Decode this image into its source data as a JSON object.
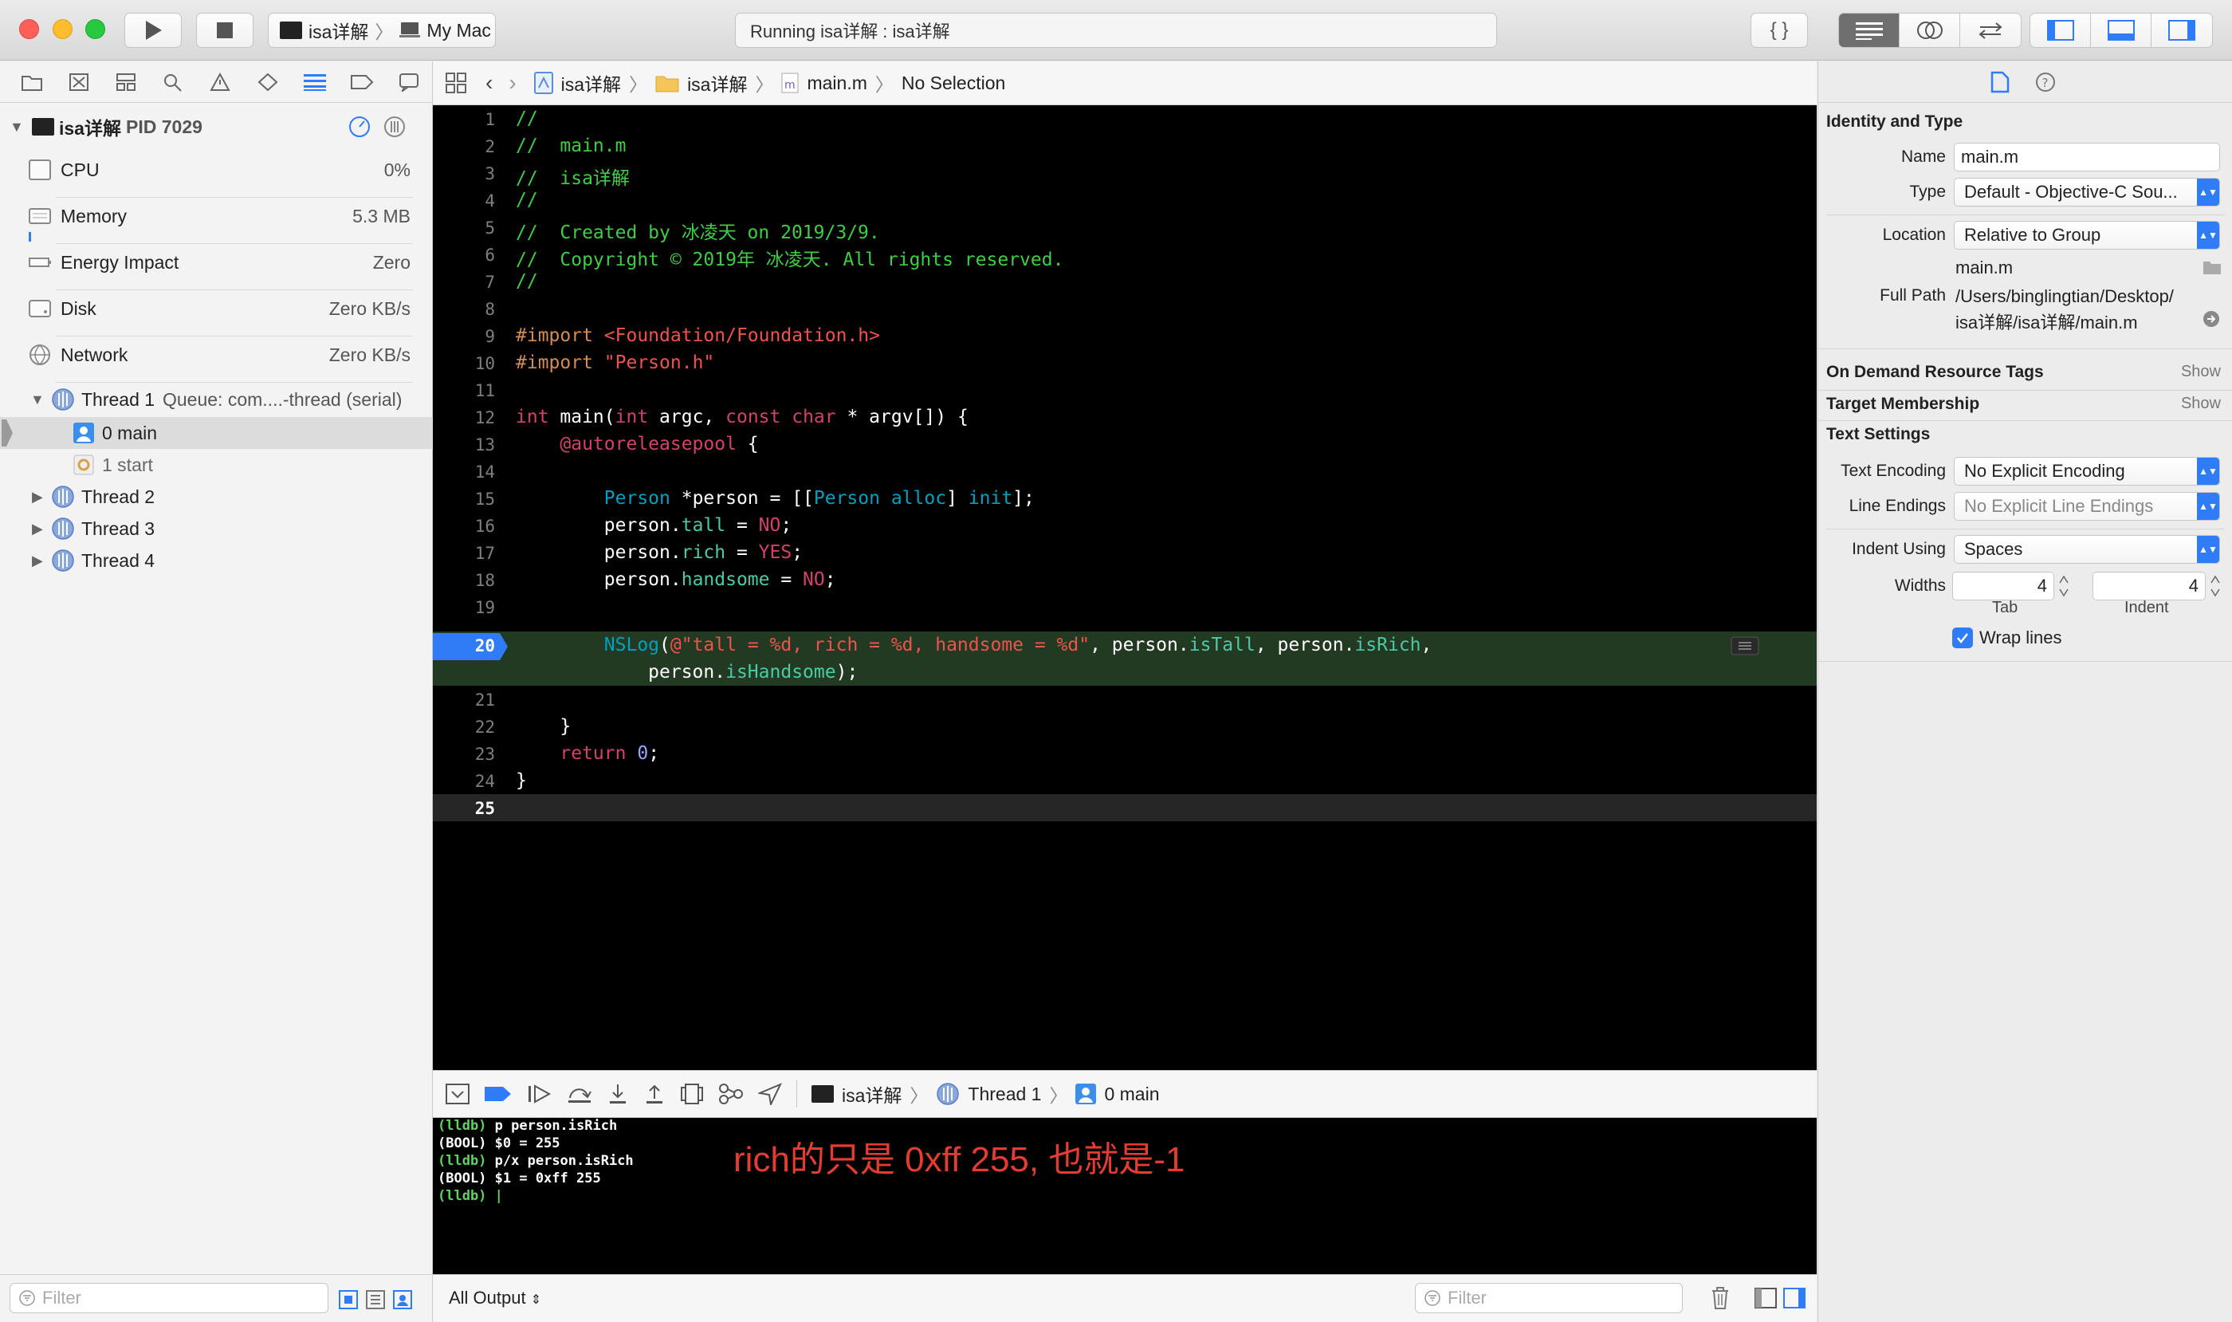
{
  "toolbar": {
    "scheme_target": "isa详解",
    "scheme_device": "My Mac",
    "status": "Running isa详解 : isa详解",
    "editor_icon": "braces-icon"
  },
  "navigator": {
    "process_label": "isa详解",
    "process_pid": "PID 7029",
    "gauges": [
      {
        "name": "CPU",
        "value": "0%"
      },
      {
        "name": "Memory",
        "value": "5.3 MB"
      },
      {
        "name": "Energy Impact",
        "value": "Zero"
      },
      {
        "name": "Disk",
        "value": "Zero KB/s"
      },
      {
        "name": "Network",
        "value": "Zero KB/s"
      }
    ],
    "thread1_label": "Thread 1",
    "thread1_queue": "Queue: com....-thread (serial)",
    "frames": [
      "0 main",
      "1 start"
    ],
    "threads": [
      "Thread 2",
      "Thread 3",
      "Thread 4"
    ],
    "filter_placeholder": "Filter"
  },
  "jumpbar": {
    "project": "isa详解",
    "group": "isa详解",
    "file": "main.m",
    "selection": "No Selection"
  },
  "editor": {
    "line_numbers": [
      "1",
      "2",
      "3",
      "4",
      "5",
      "6",
      "7",
      "8",
      "9",
      "10",
      "11",
      "12",
      "13",
      "14",
      "15",
      "16",
      "17",
      "18",
      "19",
      "20",
      "",
      "21",
      "22",
      "23",
      "24",
      "25"
    ],
    "current_line": "20",
    "lines": {
      "l1": "//",
      "l2": "//  main.m",
      "l3": "//  isa详解",
      "l4": "//",
      "l5": "//  Created by 冰凌天 on 2019/3/9.",
      "l6": "//  Copyright © 2019年 冰凌天. All rights reserved.",
      "l7": "//",
      "l9_kw": "#import",
      "l9_str": "<Foundation/Foundation.h>",
      "l10_kw": "#import",
      "l10_str": "\"Person.h\"",
      "l12_a": "int",
      "l12_b": " main(",
      "l12_c": "int",
      "l12_d": " argc, ",
      "l12_e": "const",
      "l12_f": " ",
      "l12_g": "char",
      "l12_h": " * argv[]) {",
      "l13": "@autoreleasepool",
      "l13_b": " {",
      "l15_a": "Person",
      "l15_b": " *person = [[",
      "l15_c": "Person",
      "l15_d": " alloc",
      "l15_e": "] ",
      "l15_f": "init",
      "l15_g": "];",
      "l16_a": "person.",
      "l16_b": "tall",
      "l16_c": " = ",
      "l16_d": "NO",
      "l16_e": ";",
      "l17_a": "person.",
      "l17_b": "rich",
      "l17_c": " = ",
      "l17_d": "YES",
      "l17_e": ";",
      "l18_a": "person.",
      "l18_b": "handsome",
      "l18_c": " = ",
      "l18_d": "NO",
      "l18_e": ";",
      "l20_a": "NSLog",
      "l20_b": "(",
      "l20_c": "@\"tall = %d, rich = %d, handsome = %d\"",
      "l20_d": ", person.",
      "l20_e": "isTall",
      "l20_f": ", person.",
      "l20_g": "isRich",
      "l20_h": ",",
      "l20w_a": "person.",
      "l20w_b": "isHandsome",
      "l20w_c": ");",
      "l22": "}",
      "l23_a": "return",
      "l23_b": " ",
      "l23_c": "0",
      "l23_d": ";",
      "l24": "}"
    }
  },
  "debugbar": {
    "target": "isa详解",
    "thread": "Thread 1",
    "frame": "0 main"
  },
  "console": {
    "lines": [
      "(lldb) p person.isRich",
      "(BOOL) $0 = 255",
      "(lldb) p/x person.isRich",
      "(BOOL) $1 = 0xff 255",
      "(lldb) |"
    ],
    "annotation": "rich的只是 0xff 255, 也就是-1",
    "output_selector": "All Output",
    "filter_placeholder": "Filter"
  },
  "inspector": {
    "section_identity": "Identity and Type",
    "name_label": "Name",
    "name_value": "main.m",
    "type_label": "Type",
    "type_value": "Default - Objective-C Sou...",
    "location_label": "Location",
    "location_value": "Relative to Group",
    "location_file": "main.m",
    "fullpath_label": "Full Path",
    "fullpath_line1": "/Users/binglingtian/Desktop/",
    "fullpath_line2": "isa详解/isa详解/main.m",
    "section_odr": "On Demand Resource Tags",
    "section_target": "Target Membership",
    "show_label": "Show",
    "section_text": "Text Settings",
    "encoding_label": "Text Encoding",
    "encoding_value": "No Explicit Encoding",
    "endings_label": "Line Endings",
    "endings_value": "No Explicit Line Endings",
    "indent_label": "Indent Using",
    "indent_value": "Spaces",
    "widths_label": "Widths",
    "tab_value": "4",
    "indent_width_value": "4",
    "tab_caption": "Tab",
    "indent_caption": "Indent",
    "wrap_label": "Wrap lines"
  },
  "colors": {
    "accent": "#2f7cf6",
    "comment": "#41cc45",
    "keyword": "#d3426b",
    "string": "#f0524f",
    "current_line_bg": "#223922"
  }
}
